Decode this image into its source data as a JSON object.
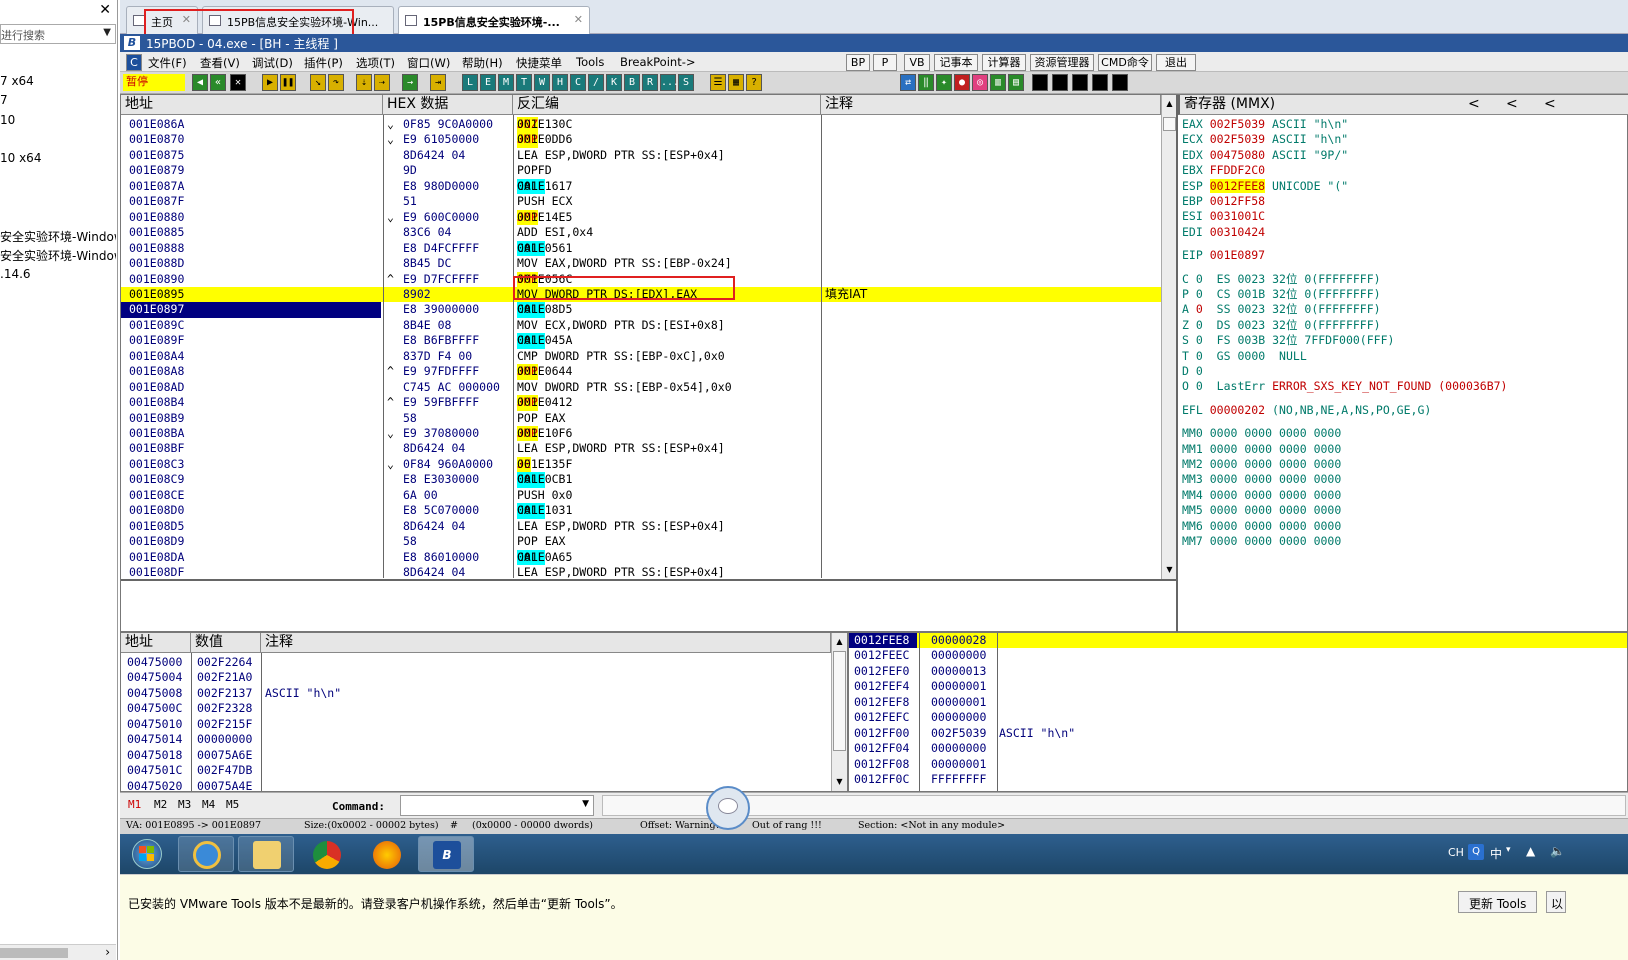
{
  "host": {
    "search_placeholder": "进行搜索",
    "items": [
      "7 x64",
      "7",
      "10",
      "10 x64",
      "安全实验环境-Windows",
      "安全实验环境-Windows",
      ".14.6"
    ]
  },
  "tabs": [
    {
      "label": "主页"
    },
    {
      "label": "15PB信息安全实验环境-Win..."
    },
    {
      "label": "15PB信息安全实验环境-..."
    }
  ],
  "titlebar": {
    "title": "15PBOD - 04.exe - [BH - 主线程 ]"
  },
  "menu": {
    "items": [
      "文件(F)",
      "查看(V)",
      "调试(D)",
      "插件(P)",
      "选项(T)",
      "窗口(W)",
      "帮助(H)",
      "快捷菜单",
      "Tools",
      "BreakPoint->"
    ],
    "buttons": [
      "BP",
      "P",
      "VB",
      "记事本",
      "计算器",
      "资源管理器",
      "CMD命令",
      "退出"
    ],
    "small_c": "C"
  },
  "toolbar": {
    "status": "暂停",
    "letters": [
      "L",
      "E",
      "M",
      "T",
      "W",
      "H",
      "C",
      "/",
      "K",
      "B",
      "R",
      "...",
      "S"
    ]
  },
  "cpu": {
    "headers": {
      "address": "地址",
      "hex": "HEX 数据",
      "disasm": "反汇编",
      "comment": "注释",
      "registers": "寄存器 (MMX)"
    },
    "rows": [
      {
        "addr": "001E086A",
        "mark": "⌄",
        "hex": "0F85 9C0A0000",
        "op": "JNZ",
        "kind": "jmp",
        "args": "001E130C",
        "comment": ""
      },
      {
        "addr": "001E0870",
        "mark": "⌄",
        "hex": "E9 61050000",
        "op": "JMP",
        "kind": "jmp",
        "args": "001E0DD6",
        "comment": ""
      },
      {
        "addr": "001E0875",
        "mark": "",
        "hex": "8D6424 04",
        "op": "",
        "kind": "",
        "args": "LEA ESP,DWORD PTR SS:[ESP+0x4]",
        "comment": ""
      },
      {
        "addr": "001E0879",
        "mark": "",
        "hex": "9D",
        "op": "",
        "kind": "",
        "args": "POPFD",
        "comment": ""
      },
      {
        "addr": "001E087A",
        "mark": "",
        "hex": "E8 980D0000",
        "op": "CALL",
        "kind": "call",
        "args": "001E1617",
        "comment": ""
      },
      {
        "addr": "001E087F",
        "mark": "",
        "hex": "51",
        "op": "",
        "kind": "",
        "args": "PUSH ECX",
        "comment": ""
      },
      {
        "addr": "001E0880",
        "mark": "⌄",
        "hex": "E9 600C0000",
        "op": "JMP",
        "kind": "jmp",
        "args": "001E14E5",
        "comment": ""
      },
      {
        "addr": "001E0885",
        "mark": "",
        "hex": "83C6 04",
        "op": "",
        "kind": "",
        "args": "ADD ESI,0x4",
        "comment": ""
      },
      {
        "addr": "001E0888",
        "mark": "",
        "hex": "E8 D4FCFFFF",
        "op": "CALL",
        "kind": "call",
        "args": "001E0561",
        "comment": ""
      },
      {
        "addr": "001E088D",
        "mark": "",
        "hex": "8B45 DC",
        "op": "",
        "kind": "",
        "args": "MOV EAX,DWORD PTR SS:[EBP-0x24]",
        "comment": ""
      },
      {
        "addr": "001E0890",
        "mark": "^",
        "hex": "E9 D7FCFFFF",
        "op": "JMP",
        "kind": "jmp",
        "args": "001E056C",
        "comment": ""
      },
      {
        "addr": "001E0895",
        "mark": "",
        "hex": "8902",
        "op": "",
        "kind": "",
        "args": "MOV DWORD PTR DS:[EDX],EAX",
        "comment": "填充IAT"
      },
      {
        "addr": "001E0897",
        "mark": "",
        "hex": "E8 39000000",
        "op": "CALL",
        "kind": "call",
        "args": "001E08D5",
        "comment": ""
      },
      {
        "addr": "001E089C",
        "mark": "",
        "hex": "8B4E 08",
        "op": "",
        "kind": "",
        "args": "MOV ECX,DWORD PTR DS:[ESI+0x8]",
        "comment": ""
      },
      {
        "addr": "001E089F",
        "mark": "",
        "hex": "E8 B6FBFFFF",
        "op": "CALL",
        "kind": "call",
        "args": "001E045A",
        "comment": ""
      },
      {
        "addr": "001E08A4",
        "mark": "",
        "hex": "837D F4 00",
        "op": "",
        "kind": "",
        "args": "CMP DWORD PTR SS:[EBP-0xC],0x0",
        "comment": ""
      },
      {
        "addr": "001E08A8",
        "mark": "^",
        "hex": "E9 97FDFFFF",
        "op": "JMP",
        "kind": "jmp",
        "args": "001E0644",
        "comment": ""
      },
      {
        "addr": "001E08AD",
        "mark": "",
        "hex": "C745 AC 000000",
        "op": "",
        "kind": "",
        "args": "MOV DWORD PTR SS:[EBP-0x54],0x0",
        "comment": ""
      },
      {
        "addr": "001E08B4",
        "mark": "^",
        "hex": "E9 59FBFFFF",
        "op": "JMP",
        "kind": "jmp",
        "args": "001E0412",
        "comment": ""
      },
      {
        "addr": "001E08B9",
        "mark": "",
        "hex": "58",
        "op": "",
        "kind": "",
        "args": "POP EAX",
        "comment": ""
      },
      {
        "addr": "001E08BA",
        "mark": "⌄",
        "hex": "E9 37080000",
        "op": "JMP",
        "kind": "jmp",
        "args": "001E10F6",
        "comment": ""
      },
      {
        "addr": "001E08BF",
        "mark": "",
        "hex": "8D6424 04",
        "op": "",
        "kind": "",
        "args": "LEA ESP,DWORD PTR SS:[ESP+0x4]",
        "comment": ""
      },
      {
        "addr": "001E08C3",
        "mark": "⌄",
        "hex": "0F84 960A0000",
        "op": "JE",
        "kind": "jmp",
        "args": "001E135F",
        "comment": ""
      },
      {
        "addr": "001E08C9",
        "mark": "",
        "hex": "E8 E3030000",
        "op": "CALL",
        "kind": "call",
        "args": "001E0CB1",
        "comment": ""
      },
      {
        "addr": "001E08CE",
        "mark": "",
        "hex": "6A 00",
        "op": "",
        "kind": "",
        "args": "PUSH 0x0",
        "comment": ""
      },
      {
        "addr": "001E08D0",
        "mark": "",
        "hex": "E8 5C070000",
        "op": "CALL",
        "kind": "call",
        "args": "001E1031",
        "comment": ""
      },
      {
        "addr": "001E08D5",
        "mark": "",
        "hex": "8D6424 04",
        "op": "",
        "kind": "",
        "args": "LEA ESP,DWORD PTR SS:[ESP+0x4]",
        "comment": ""
      },
      {
        "addr": "001E08D9",
        "mark": "",
        "hex": "58",
        "op": "",
        "kind": "",
        "args": "POP EAX",
        "comment": ""
      },
      {
        "addr": "001E08DA",
        "mark": "",
        "hex": "E8 86010000",
        "op": "CALL",
        "kind": "call",
        "args": "001E0A65",
        "comment": ""
      },
      {
        "addr": "001E08DF",
        "mark": "",
        "hex": "8D6424 04",
        "op": "",
        "kind": "",
        "args": "LEA ESP,DWORD PTR SS:[ESP+0x4]",
        "comment": ""
      }
    ],
    "registers": {
      "nav": [
        "<",
        "<",
        "<"
      ],
      "gp": [
        {
          "name": "EAX",
          "val": "002F5039",
          "info": "ASCII \"h\\n\""
        },
        {
          "name": "ECX",
          "val": "002F5039",
          "info": "ASCII \"h\\n\""
        },
        {
          "name": "EDX",
          "val": "00475080",
          "info": "ASCII \"9P/\""
        },
        {
          "name": "EBX",
          "val": "FFDDF2C0",
          "info": ""
        },
        {
          "name": "ESP",
          "val": "0012FEE8",
          "info": "UNICODE \"(\""
        },
        {
          "name": "EBP",
          "val": "0012FF58",
          "info": ""
        },
        {
          "name": "ESI",
          "val": "0031001C",
          "info": ""
        },
        {
          "name": "EDI",
          "val": "00310424",
          "info": ""
        }
      ],
      "eip": {
        "name": "EIP",
        "val": "001E0897"
      },
      "flags": [
        {
          "f": "C",
          "v": "0",
          "seg": "ES",
          "sel": "0023",
          "bits": "32位",
          "desc": "0(FFFFFFFF)"
        },
        {
          "f": "P",
          "v": "0",
          "seg": "CS",
          "sel": "001B",
          "bits": "32位",
          "desc": "0(FFFFFFFF)"
        },
        {
          "f": "A",
          "v": "0",
          "seg": "SS",
          "sel": "0023",
          "bits": "32位",
          "desc": "0(FFFFFFFF)"
        },
        {
          "f": "Z",
          "v": "0",
          "seg": "DS",
          "sel": "0023",
          "bits": "32位",
          "desc": "0(FFFFFFFF)"
        },
        {
          "f": "S",
          "v": "0",
          "seg": "FS",
          "sel": "003B",
          "bits": "32位",
          "desc": "7FFDF000(FFF)"
        },
        {
          "f": "T",
          "v": "0",
          "seg": "GS",
          "sel": "0000",
          "bits": "",
          "desc": "NULL"
        }
      ],
      "d_flag": {
        "f": "D",
        "v": "0"
      },
      "o_flag": {
        "f": "O",
        "v": "0",
        "label": "LastErr",
        "err": "ERROR_SXS_KEY_NOT_FOUND (000036B7)"
      },
      "efl": {
        "name": "EFL",
        "val": "00000202",
        "info": "(NO,NB,NE,A,NS,PO,GE,G)"
      },
      "mmx": [
        {
          "name": "MM0",
          "val": "0000 0000 0000 0000"
        },
        {
          "name": "MM1",
          "val": "0000 0000 0000 0000"
        },
        {
          "name": "MM2",
          "val": "0000 0000 0000 0000"
        },
        {
          "name": "MM3",
          "val": "0000 0000 0000 0000"
        },
        {
          "name": "MM4",
          "val": "0000 0000 0000 0000"
        },
        {
          "name": "MM5",
          "val": "0000 0000 0000 0000"
        },
        {
          "name": "MM6",
          "val": "0000 0000 0000 0000"
        },
        {
          "name": "MM7",
          "val": "0000 0000 0000 0000"
        }
      ]
    }
  },
  "dump": {
    "headers": {
      "address": "地址",
      "value": "数值",
      "comment": "注释"
    },
    "rows": [
      {
        "addr": "00475000",
        "val": "002F2264",
        "comment": ""
      },
      {
        "addr": "00475004",
        "val": "002F21A0",
        "comment": ""
      },
      {
        "addr": "00475008",
        "val": "002F2137",
        "comment": "ASCII \"h\\n\""
      },
      {
        "addr": "0047500C",
        "val": "002F2328",
        "comment": ""
      },
      {
        "addr": "00475010",
        "val": "002F215F",
        "comment": ""
      },
      {
        "addr": "00475014",
        "val": "00000000",
        "comment": ""
      },
      {
        "addr": "00475018",
        "val": "00075A6E",
        "comment": ""
      },
      {
        "addr": "0047501C",
        "val": "002F47DB",
        "comment": ""
      },
      {
        "addr": "00475020",
        "val": "00075A4E",
        "comment": ""
      }
    ]
  },
  "stack": {
    "rows": [
      {
        "addr": "0012FEE8",
        "val": "00000028",
        "comment": ""
      },
      {
        "addr": "0012FEEC",
        "val": "00000000",
        "comment": ""
      },
      {
        "addr": "0012FEF0",
        "val": "00000013",
        "comment": ""
      },
      {
        "addr": "0012FEF4",
        "val": "00000001",
        "comment": ""
      },
      {
        "addr": "0012FEF8",
        "val": "00000001",
        "comment": ""
      },
      {
        "addr": "0012FEFC",
        "val": "00000000",
        "comment": ""
      },
      {
        "addr": "0012FF00",
        "val": "002F5039",
        "comment": "ASCII \"h\\n\""
      },
      {
        "addr": "0012FF04",
        "val": "00000000",
        "comment": ""
      },
      {
        "addr": "0012FF08",
        "val": "00000001",
        "comment": ""
      },
      {
        "addr": "0012FF0C",
        "val": "FFFFFFFF",
        "comment": ""
      }
    ]
  },
  "command": {
    "tabs": [
      "M1",
      "M2",
      "M3",
      "M4",
      "M5"
    ],
    "label": "Command:",
    "value": ""
  },
  "status": {
    "va": "VA: 001E0895 -> 001E0897",
    "size": "Size:(0x0002 - 00002 bytes)",
    "hash": "#",
    "range": "(0x0000 - 00000 dwords)",
    "offset": "Offset: Warning!",
    "outrange": "Out of rang !!!",
    "section": "Section: <Not in any module>"
  },
  "systray": {
    "lang": "CH",
    "ime": "中"
  },
  "notice": {
    "message": "已安装的 VMware Tools 版本不是最新的。请登录客户机操作系统，然后单击“更新 Tools”。",
    "update_button": "更新 Tools",
    "other_button": "以"
  },
  "colors": {
    "highlight": "#ffff00",
    "annotation_red": "#e02020",
    "title_blue": "#2b579a"
  }
}
